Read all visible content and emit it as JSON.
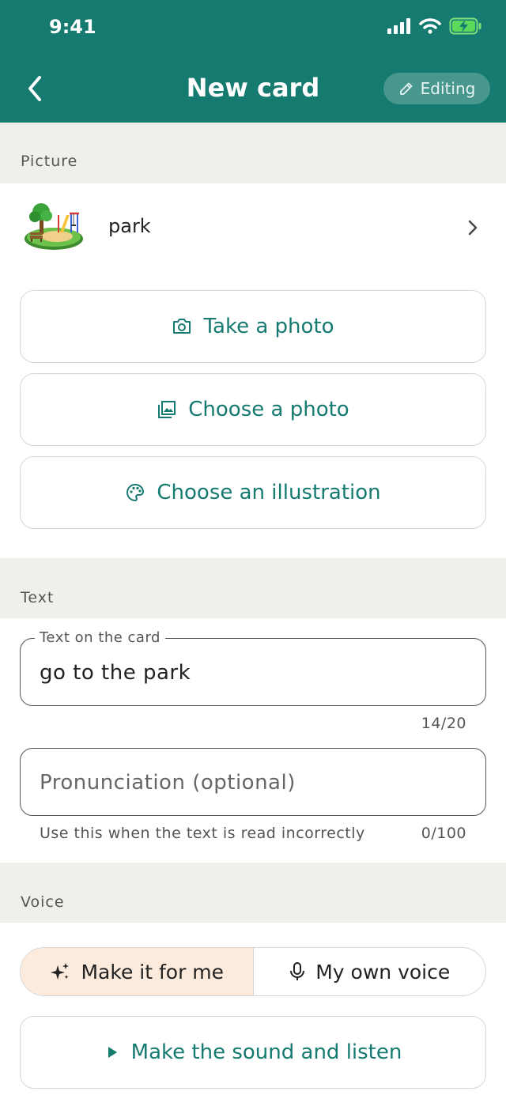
{
  "status": {
    "time": "9:41"
  },
  "header": {
    "title": "New card",
    "editing_label": "Editing"
  },
  "picture": {
    "section_label": "Picture",
    "selected_name": "park",
    "buttons": {
      "take_photo": "Take a photo",
      "choose_photo": "Choose a photo",
      "choose_illustration": "Choose an illustration"
    }
  },
  "text": {
    "section_label": "Text",
    "card_text": {
      "label": "Text on the card",
      "value": "go to the park",
      "counter": "14/20"
    },
    "pronunciation": {
      "placeholder": "Pronunciation (optional)",
      "helper": "Use this when the text is read incorrectly",
      "counter": "0/100"
    }
  },
  "voice": {
    "section_label": "Voice",
    "options": [
      "Make it for me",
      "My own voice"
    ],
    "selected": "Make it for me",
    "listen_button": "Make the sound and listen"
  },
  "colors": {
    "primary": "#157a70",
    "band": "#f1efeb",
    "selected_segment": "#fcebdc"
  }
}
